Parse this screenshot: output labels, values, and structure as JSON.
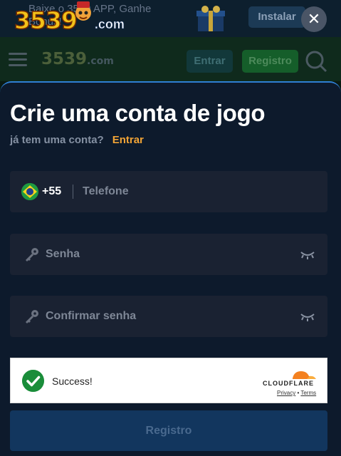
{
  "app_banner": {
    "text": "Baixe o 3539 APP, Ganhe Bônus!",
    "install_label": "Instalar",
    "close_symbol": "✕"
  },
  "logo": {
    "number": "3539",
    "domain": ".com"
  },
  "header": {
    "logo_number": "3539",
    "logo_domain": ".com",
    "login_label": "Entrar",
    "register_label": "Registro"
  },
  "modal": {
    "title": "Crie uma conta de jogo",
    "have_account": "já tem uma conta?",
    "login_link": "Entrar",
    "phone": {
      "country_code": "+55",
      "placeholder": "Telefone",
      "flag": "brazil-flag-icon"
    },
    "password": {
      "placeholder": "Senha"
    },
    "confirm_password": {
      "placeholder": "Confirmar senha"
    },
    "captcha": {
      "status": "Success!",
      "brand": "CLOUDFLARE",
      "privacy": "Privacy",
      "separator": "•",
      "terms": "Terms"
    },
    "submit_label": "Registro"
  },
  "colors": {
    "accent_link": "#f2a436",
    "sheet_border": "#2f7fd3",
    "sheet_bg": "#0d1a2c",
    "success_green": "#1a8d3a",
    "cloudflare_orange": "#f48120"
  }
}
